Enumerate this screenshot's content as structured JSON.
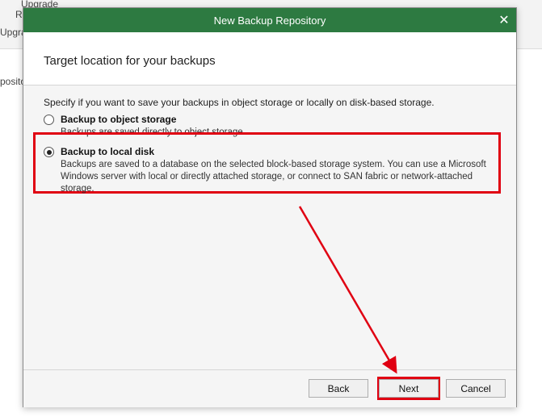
{
  "background": {
    "frag_upgrade": "Upgrade",
    "frag_r": "R",
    "frag_upgra": "Upgra",
    "frag_repository": "pository"
  },
  "dialog": {
    "title": "New Backup Repository",
    "close_icon": "close-icon",
    "header_title": "Target location for your backups",
    "instruction": "Specify if you want to save your backups in object storage or locally on disk-based storage.",
    "options": [
      {
        "label": "Backup to object storage",
        "description": "Backups are saved directly to object storage.",
        "selected": false
      },
      {
        "label": "Backup to local disk",
        "description": "Backups are saved to a database on the selected block-based storage system. You can use a Microsoft Windows server with local or directly attached storage, or connect to SAN fabric or network-attached storage.",
        "selected": true
      }
    ],
    "buttons": {
      "back": "Back",
      "next": "Next",
      "cancel": "Cancel"
    }
  },
  "colors": {
    "titlebar": "#2d7a41",
    "highlight": "#e00012"
  }
}
